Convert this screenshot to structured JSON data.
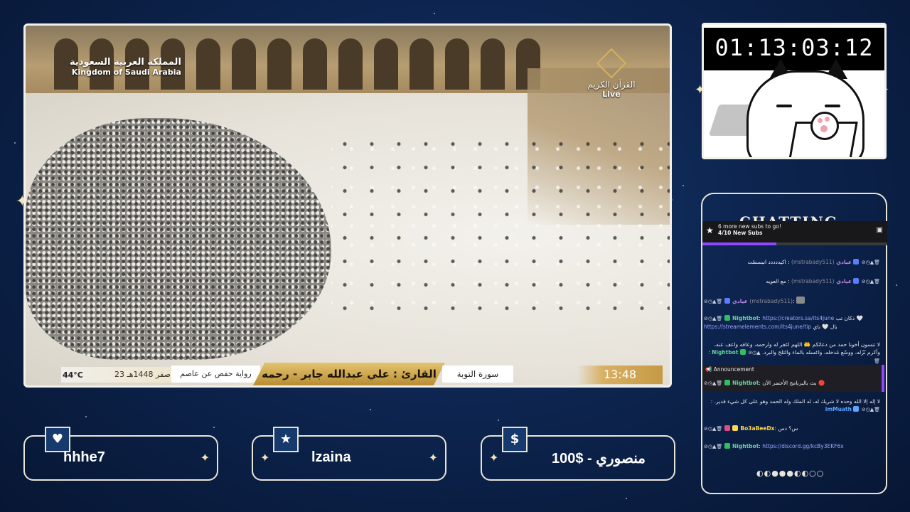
{
  "video": {
    "country_ar": "المملكة العربية السعودية",
    "country_en": "Kingdom of Saudi Arabia",
    "channel_ar": "القرآن الكريم",
    "channel_live": "Live",
    "temperature": "44°C",
    "date_hijri": "23 صفر 1448هـ",
    "narration": "رواية حفص عن عاصم",
    "reader": "القارئ : علي عبدالله جابر - رحمه الله",
    "surah": "سورة التوبة",
    "time": "13:48"
  },
  "timer": {
    "value": "01:13:03:12"
  },
  "chat": {
    "title": "CHATTING",
    "sub_goal": {
      "headline": "6 more new subs to go!",
      "count": "4/10 New Subs",
      "progress": 0.4
    },
    "messages": [
      {
        "user": "عيادي",
        "handle": "(mstrabady511)",
        "text": "اكيددددد انبسطت"
      },
      {
        "user": "عيادي",
        "handle": "(mstrabady511)",
        "text": "مع العويه"
      },
      {
        "user": "عيادي",
        "handle": "(mstrabady511)",
        "text": ""
      },
      {
        "user": "Nightbot",
        "text": "دكان تب 🤍",
        "link1": "https://creators.sa/its4june",
        "mid": "بال 🤍 ناي",
        "link2": "https://streamelements.com/its4june/tip"
      },
      {
        "user": "Nightbot",
        "text": "لا تنسون أخونا حمد من دعائكم 🤲 اللهم اغفر له وارحمه، وعافه واعف عنه، وأكرم نُزُله، ووسّع مُدخله، واغسله بالماء والثلج والبرد."
      },
      {
        "user": "Nightbot",
        "text": "بث بالبرنامج الأخضر الآن 🔴"
      },
      {
        "user": "imMuath",
        "text": "لا إله إلا الله وحده لا شريك له، له الملك وله الحمد وهو على كل شيء قدير."
      },
      {
        "user": "Bo3aBeeDx",
        "text": "س؟ دس"
      },
      {
        "user": "Nightbot",
        "link1": "https://discord.gg/kcBy3EKF6x"
      }
    ],
    "announcement_label": "Announcement",
    "pager": "◐◐●●●◐◐○○"
  },
  "cards": [
    {
      "icon": "♥",
      "text": "hhhe7"
    },
    {
      "icon": "★",
      "text": "lzaina"
    },
    {
      "icon": "$",
      "text": "منصوري - $100"
    }
  ],
  "colors": {
    "background": "#0d2550",
    "frame": "#f4f1ea",
    "gold": "#d6b15c",
    "twitch_purple": "#9147ff"
  }
}
